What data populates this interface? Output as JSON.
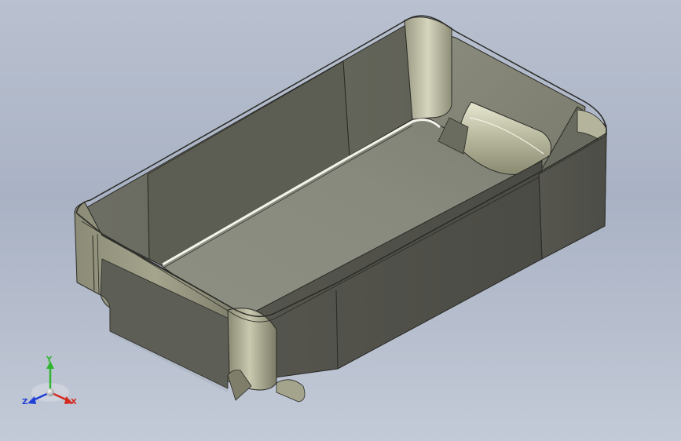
{
  "scene": {
    "model": "tray-part",
    "background_top": "#b9c1d0",
    "background_bottom": "#c3cad7"
  },
  "triad": {
    "x_label": "X",
    "y_label": "Y",
    "z_label": "Z",
    "x_color": "#d42a1e",
    "y_color": "#2fb52f",
    "z_color": "#1f3fd6"
  }
}
